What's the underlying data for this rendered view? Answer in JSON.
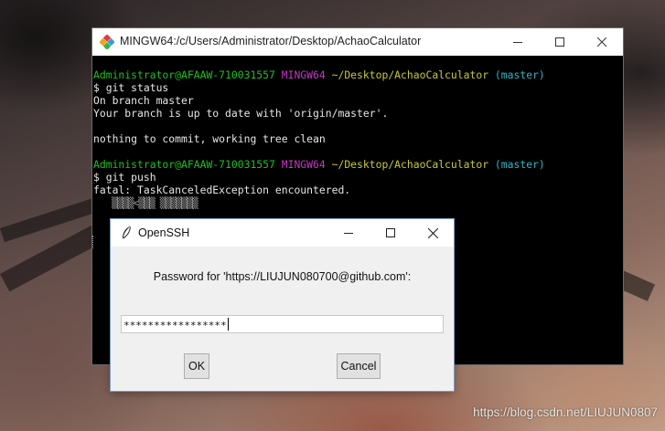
{
  "terminal": {
    "title": "MINGW64:/c/Users/Administrator/Desktop/AchaoCalculator",
    "prompt": {
      "user_host": "Administrator@AFAAW-710031557",
      "env": "MINGW64",
      "path": "~/Desktop/AchaoCalculator",
      "branch": "(master)"
    },
    "lines": [
      "$ git status",
      "On branch master",
      "Your branch is up to date with 'origin/master'.",
      "",
      "nothing to commit, working tree clean",
      "$ git push",
      "fatal: TaskCanceledException encountered.",
      "▒▒▒▒<▒▒▒ ▒▒▒▒▒▒▒"
    ]
  },
  "dialog": {
    "title": "OpenSSH",
    "prompt": "Password for 'https://LIUJUN080700@github.com':",
    "password_value": "*****************",
    "ok_label": "OK",
    "cancel_label": "Cancel"
  },
  "watermark": "https://blog.csdn.net/LIUJUN0807",
  "colors": {
    "prompt_user": "#1dc121",
    "prompt_env": "#c837c8",
    "prompt_path": "#c9c93a",
    "prompt_branch": "#2ab8c8"
  }
}
